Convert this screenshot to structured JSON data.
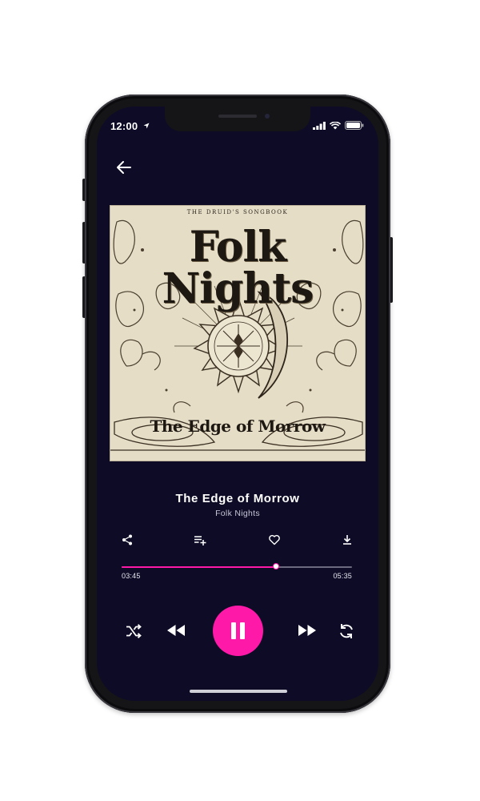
{
  "status_bar": {
    "time": "12:00"
  },
  "album": {
    "subtitle": "THE DRUID'S SONGBOOK",
    "title": "Folk Nights",
    "track_name_art": "The Edge of Morrow"
  },
  "track": {
    "title": "The Edge of Morrow",
    "artist": "Folk Nights"
  },
  "progress": {
    "elapsed": "03:45",
    "duration": "05:35",
    "fraction": 0.67
  },
  "colors": {
    "accent": "#ff19a8",
    "background": "#0d0b26"
  },
  "icons": {
    "back": "arrow-left-icon",
    "actions": [
      "share-icon",
      "add-to-playlist-icon",
      "heart-icon",
      "download-icon"
    ],
    "controls": [
      "shuffle-icon",
      "rewind-icon",
      "pause-icon",
      "fast-forward-icon",
      "repeat-icon"
    ]
  }
}
